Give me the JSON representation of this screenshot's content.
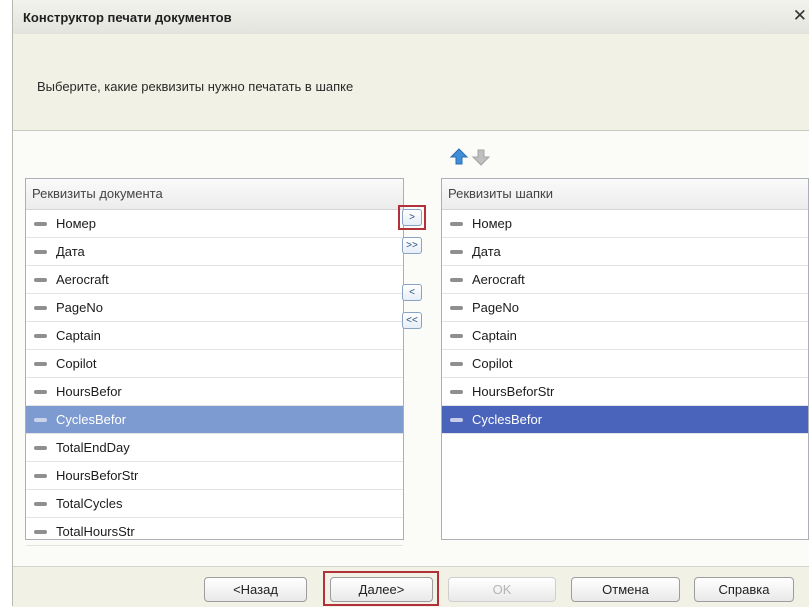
{
  "window": {
    "title": "Конструктор печати документов",
    "close_glyph": "✕"
  },
  "header": {
    "prompt": "Выберите, какие реквизиты нужно печатать в шапке"
  },
  "toolbar": {
    "up_icon": "arrow-up-icon",
    "down_icon": "arrow-down-icon",
    "accent": "#3f8fd8"
  },
  "left_panel": {
    "title": "Реквизиты документа",
    "items": [
      "Номер",
      "Дата",
      "Aerocraft",
      "PageNo",
      "Captain",
      "Copilot",
      "HoursBefor",
      "CyclesBefor",
      "TotalEndDay",
      "HoursBeforStr",
      "TotalCycles",
      "TotalHoursStr"
    ],
    "selected": "CyclesBefor"
  },
  "right_panel": {
    "title": "Реквизиты шапки",
    "items": [
      "Номер",
      "Дата",
      "Aerocraft",
      "PageNo",
      "Captain",
      "Copilot",
      "HoursBeforStr",
      "CyclesBefor"
    ],
    "selected": "CyclesBefor"
  },
  "move_buttons": {
    "add": ">",
    "add_all": ">>",
    "remove": "<",
    "remove_all": "<<"
  },
  "footer": {
    "back": "<Назад",
    "next": "Далее>",
    "ok": "OK",
    "cancel": "Отмена",
    "help": "Справка"
  },
  "colors": {
    "selection_inactive": "#7d9bd0",
    "selection_active": "#4a63bb",
    "highlight_box": "#b2303a"
  }
}
